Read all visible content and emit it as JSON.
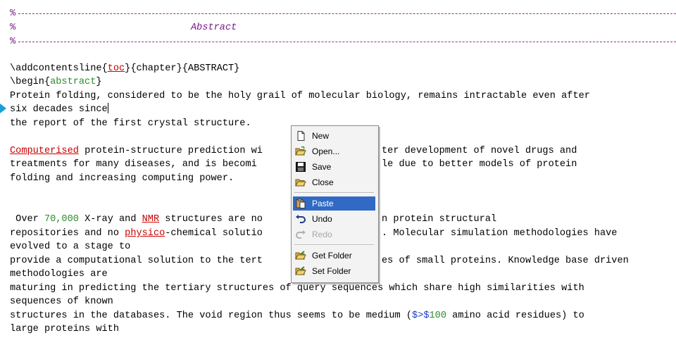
{
  "editor": {
    "comment_prefix": "%",
    "section_title": "Abstract",
    "lines": {
      "l1_pre": "\\addcontentsline{",
      "l1_toc": "toc",
      "l1_post": "}{chapter}{ABSTRACT}",
      "l2_pre": "\\begin{",
      "l2_abs": "abstract",
      "l2_post": "}",
      "l3": "Protein folding, considered to be the holy grail of molecular biology, remains intractable even after",
      "l4": "six decades since",
      "l5": "the report of the first crystal structure.",
      "l6_word": "Computerised",
      "l6_rest": " protein-structure prediction wi",
      "l6_right": "ter development of novel drugs and",
      "l7_left": "treatments for many diseases, and is becomi",
      "l7_right": "le due to better models of protein",
      "l8": "folding and increasing computing power.",
      "l9_a": " Over ",
      "l9_num": "70,000",
      "l9_b": " X-ray and ",
      "l9_nmr": "NMR",
      "l9_c": " structures are no",
      "l9_right": "n protein structural",
      "l10_a": "repositories and no ",
      "l10_word": "physico",
      "l10_b": "-chemical solutio",
      "l10_right": ". Molecular simulation methodologies have",
      "l11": "evolved to a stage to",
      "l12_left": "provide a computational solution to the tert",
      "l12_right": "es of small proteins. Knowledge base driven",
      "l13": "methodologies are",
      "l14": "maturing in predicting the tertiary structures of query sequences which share high similarities with",
      "l15": "sequences of known",
      "l16_a": "structures in the databases. The void region thus seems to be medium (",
      "l16_math": "$>$",
      "l16_num": "100",
      "l16_b": " amino acid residues) to",
      "l17": "large proteins with"
    }
  },
  "context_menu": {
    "items": {
      "new": "New",
      "open": "Open...",
      "save": "Save",
      "close": "Close",
      "paste": "Paste",
      "undo": "Undo",
      "redo": "Redo",
      "get_folder": "Get Folder",
      "set_folder": "Set Folder"
    },
    "selected": "Paste",
    "disabled": [
      "Redo"
    ],
    "highlight_color": "#316ac5"
  },
  "colors": {
    "comment": "#7a1a8a",
    "misspelled": "#c80000",
    "number": "#2e8b2e",
    "math": "#1a3cc8",
    "marker": "#1aa0d8"
  }
}
